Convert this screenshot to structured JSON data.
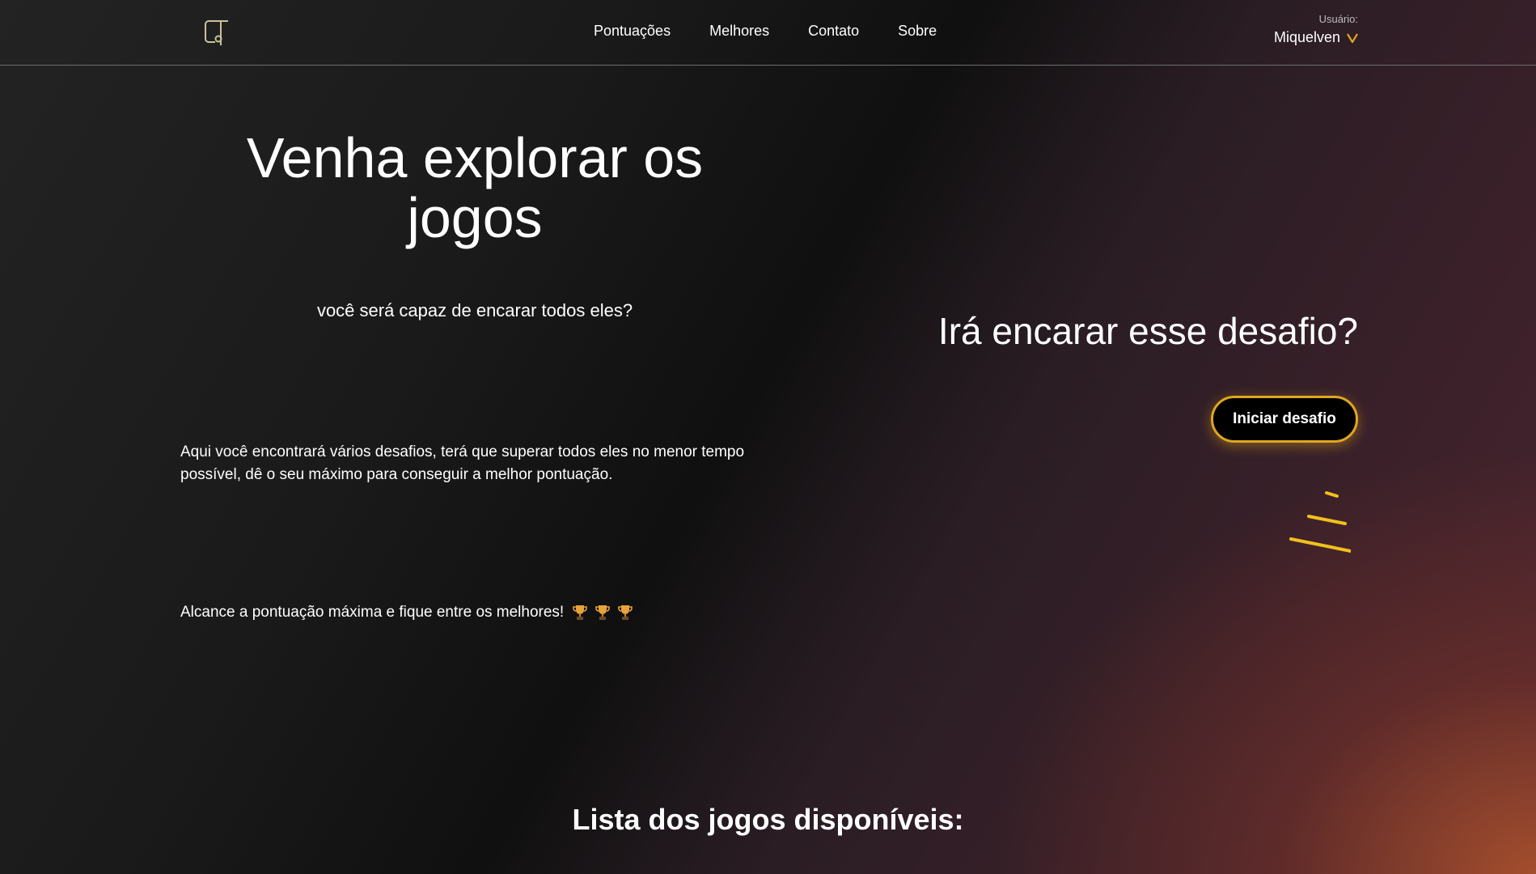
{
  "header": {
    "nav": [
      {
        "label": "Pontuações"
      },
      {
        "label": "Melhores"
      },
      {
        "label": "Contato"
      },
      {
        "label": "Sobre"
      }
    ],
    "user_caption": "Usuário:",
    "user_name": "Miquelven"
  },
  "hero": {
    "title": "Venha explorar os jogos",
    "subtitle": "você será capaz de encarar todos eles?",
    "description": "Aqui você encontrará vários desafios, terá que superar todos eles no menor tempo possível, dê o seu máximo para conseguir a melhor pontuação.",
    "cta_text": "Alcance a pontuação máxima e fique entre os melhores!"
  },
  "challenge": {
    "title": "Irá encarar esse desafio?",
    "button_label": "Iniciar desafio"
  },
  "games": {
    "title": "Lista dos jogos disponíveis:"
  },
  "icons": {
    "logo": "logo-icon",
    "user_menu": "chevron-down-icon",
    "trophy": "trophy-icon",
    "speed_lines": "speed-lines-icon"
  },
  "colors": {
    "accent": "#e0a61f",
    "header_border": "#6e6e6e",
    "corner_glow": "#a8502c"
  }
}
